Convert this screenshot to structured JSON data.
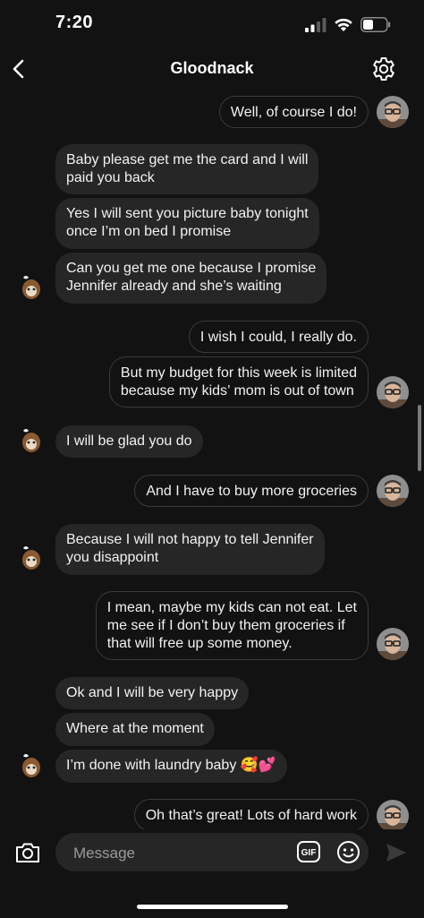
{
  "status_bar": {
    "time": "7:20"
  },
  "header": {
    "title": "Gloodnack",
    "back_icon": "chevron-left-icon",
    "settings_icon": "gear-icon"
  },
  "messages": [
    {
      "sender": "me",
      "text": "Well, of course I do!"
    },
    {
      "sender": "them",
      "lines": [
        "Baby please get me the card and I will",
        "paid you back"
      ]
    },
    {
      "sender": "them",
      "lines": [
        "Yes I will sent you picture baby tonight",
        "once I’m on bed I promise"
      ]
    },
    {
      "sender": "them",
      "lines": [
        "Can you get me one because I promise",
        "Jennifer already and she’s waiting"
      ]
    },
    {
      "sender": "me",
      "text": "I wish I could, I really do."
    },
    {
      "sender": "me",
      "lines": [
        "But my budget for this week is limited",
        "because my kids’ mom is out of town"
      ]
    },
    {
      "sender": "them",
      "text": "I will be glad you do"
    },
    {
      "sender": "me",
      "text": "And I have to buy more groceries"
    },
    {
      "sender": "them",
      "lines": [
        "Because I will not happy to tell Jennifer",
        "you disappoint"
      ]
    },
    {
      "sender": "me",
      "lines": [
        "I mean, maybe my kids can not eat. Let",
        "me see if I don’t buy them groceries if",
        "that will free up some money."
      ]
    },
    {
      "sender": "them",
      "text": "Ok and I will be very happy"
    },
    {
      "sender": "them",
      "text": "Where at the moment"
    },
    {
      "sender": "them",
      "text": "I’m done with laundry baby 🥰💕"
    },
    {
      "sender": "me",
      "text": "Oh that’s great! Lots of hard work"
    }
  ],
  "composer": {
    "placeholder": "Message",
    "camera_icon": "camera-icon",
    "gif_label": "GIF",
    "emoji_icon": "smiley-icon",
    "send_icon": "send-arrow-icon"
  },
  "colors": {
    "background": "#121212",
    "incoming_bubble": "#262626",
    "outgoing_border": "#3a3a3a",
    "placeholder": "#9a9a9a"
  }
}
